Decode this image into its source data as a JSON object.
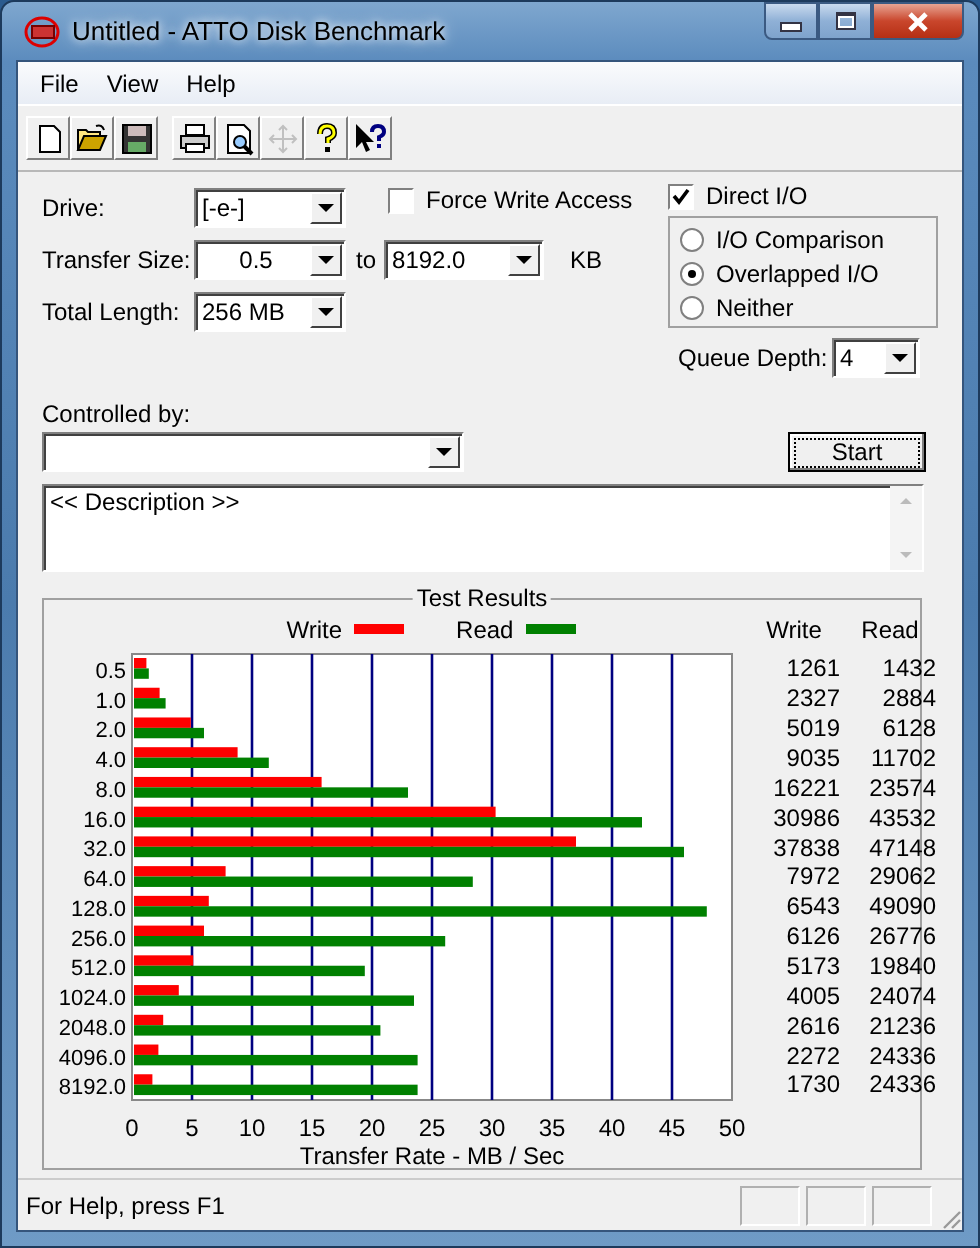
{
  "window": {
    "title": "Untitled - ATTO Disk Benchmark"
  },
  "menu": [
    "File",
    "View",
    "Help"
  ],
  "toolbar": [
    {
      "kind": "new",
      "disabled": false
    },
    {
      "kind": "open",
      "disabled": false
    },
    {
      "kind": "save",
      "disabled": false
    },
    {
      "kind": "print",
      "disabled": false
    },
    {
      "kind": "preview",
      "disabled": false
    },
    {
      "kind": "move",
      "disabled": true
    },
    {
      "kind": "help",
      "disabled": false
    },
    {
      "kind": "context-help",
      "disabled": false
    }
  ],
  "drive": {
    "label": "Drive:",
    "value": "[-e-]"
  },
  "force_write_access": {
    "label": "Force Write Access",
    "checked": false
  },
  "transfer_size": {
    "label": "Transfer Size:",
    "from": "0.5",
    "to_label": "to",
    "to": "8192.0",
    "unit": "KB"
  },
  "total_length": {
    "label": "Total Length:",
    "value": "256 MB"
  },
  "direct_io": {
    "label": "Direct I/O",
    "checked": true
  },
  "io_modes": [
    {
      "label": "I/O Comparison",
      "selected": false
    },
    {
      "label": "Overlapped I/O",
      "selected": true
    },
    {
      "label": "Neither",
      "selected": false
    }
  ],
  "queue_depth": {
    "label": "Queue Depth:",
    "value": "4"
  },
  "controlled_by": {
    "label": "Controlled by:"
  },
  "start_button": "Start",
  "description": "<< Description >>",
  "test_results": {
    "title": "Test Results",
    "columns": [
      "Write",
      "Read"
    ],
    "rows": [
      {
        "write": "1261",
        "read": "1432"
      },
      {
        "write": "2327",
        "read": "2884"
      },
      {
        "write": "5019",
        "read": "6128"
      },
      {
        "write": "9035",
        "read": "11702"
      },
      {
        "write": "16221",
        "read": "23574"
      },
      {
        "write": "30986",
        "read": "43532"
      },
      {
        "write": "37838",
        "read": "47148"
      },
      {
        "write": "7972",
        "read": "29062"
      },
      {
        "write": "6543",
        "read": "49090"
      },
      {
        "write": "6126",
        "read": "26776"
      },
      {
        "write": "5173",
        "read": "19840"
      },
      {
        "write": "4005",
        "read": "24074"
      },
      {
        "write": "2616",
        "read": "21236"
      },
      {
        "write": "2272",
        "read": "24336"
      },
      {
        "write": "1730",
        "read": "24336"
      }
    ],
    "chart_data": {
      "type": "bar",
      "orientation": "horizontal",
      "xlabel": "Transfer Rate - MB / Sec",
      "categories": [
        "0.5",
        "1.0",
        "2.0",
        "4.0",
        "8.0",
        "16.0",
        "32.0",
        "64.0",
        "128.0",
        "256.0",
        "512.0",
        "1024.0",
        "2048.0",
        "4096.0",
        "8192.0"
      ],
      "series": [
        {
          "name": "Write",
          "color": "#ff0000",
          "values": [
            1.2,
            2.3,
            4.9,
            8.8,
            15.8,
            30.3,
            37.0,
            7.8,
            6.4,
            6.0,
            5.1,
            3.9,
            2.6,
            2.2,
            1.7
          ]
        },
        {
          "name": "Read",
          "color": "#008000",
          "values": [
            1.4,
            2.8,
            6.0,
            11.4,
            23.0,
            42.5,
            46.0,
            28.4,
            47.9,
            26.1,
            19.4,
            23.5,
            20.7,
            23.8,
            23.8
          ]
        }
      ],
      "grid": true,
      "xlim": [
        0,
        50
      ],
      "xticks": [
        0,
        5,
        10,
        15,
        20,
        25,
        30,
        35,
        40,
        45,
        50
      ]
    }
  },
  "status_bar": {
    "text": "For Help, press F1"
  }
}
